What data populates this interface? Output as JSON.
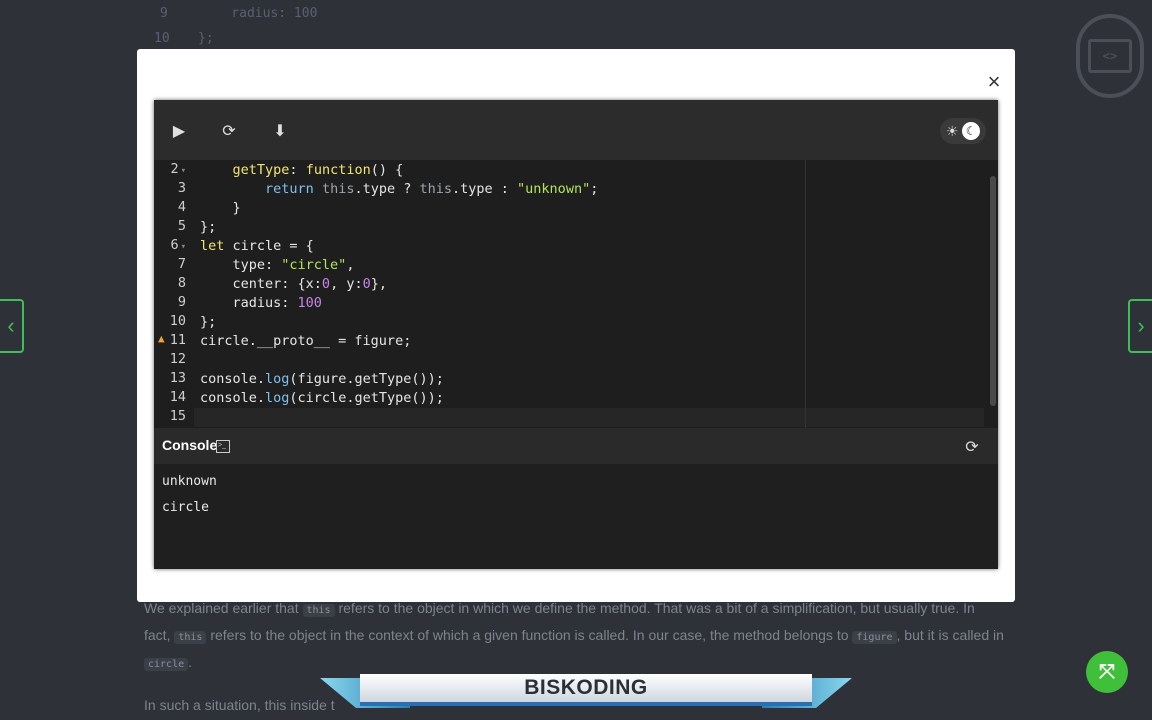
{
  "background": {
    "code_lines": [
      {
        "num": "9",
        "text": "    radius: 100"
      },
      {
        "num": "10",
        "text": "};"
      }
    ],
    "paragraph1": {
      "t1": "We explained earlier that ",
      "c1": "this",
      "t2": " refers to the object in which we define the method. That was a bit of a simplification, but usually true. In fact, ",
      "c2": "this",
      "t3": " refers to the object in the context of which a given function is called. In our case, the method belongs to ",
      "c3": "figure",
      "t4": ", but it is called in ",
      "c4": "circle",
      "t5": "."
    },
    "paragraph2": "In such a situation, this inside t"
  },
  "brand": "BISKODING",
  "modal": {
    "close_label": "×"
  },
  "toolbar": {
    "run_icon": "▶",
    "reset_icon": "⟳",
    "download_icon": "⬇",
    "sun_icon": "☀",
    "moon_icon": "☾"
  },
  "editor": {
    "lines": [
      {
        "num": "2",
        "fold": "▾"
      },
      {
        "num": "3"
      },
      {
        "num": "4"
      },
      {
        "num": "5"
      },
      {
        "num": "6",
        "fold": "▾"
      },
      {
        "num": "7"
      },
      {
        "num": "8"
      },
      {
        "num": "9"
      },
      {
        "num": "10"
      },
      {
        "num": "11",
        "warn": "▲"
      },
      {
        "num": "12"
      },
      {
        "num": "13"
      },
      {
        "num": "14"
      },
      {
        "num": "15"
      }
    ]
  },
  "console": {
    "title": "Console",
    "icon": ">_",
    "refresh_icon": "⟳",
    "output": [
      "unknown",
      "circle"
    ]
  },
  "nav": {
    "prev_icon": "‹",
    "next_icon": "›",
    "fab_icon": "⤧",
    "badge_icon": "<>"
  }
}
